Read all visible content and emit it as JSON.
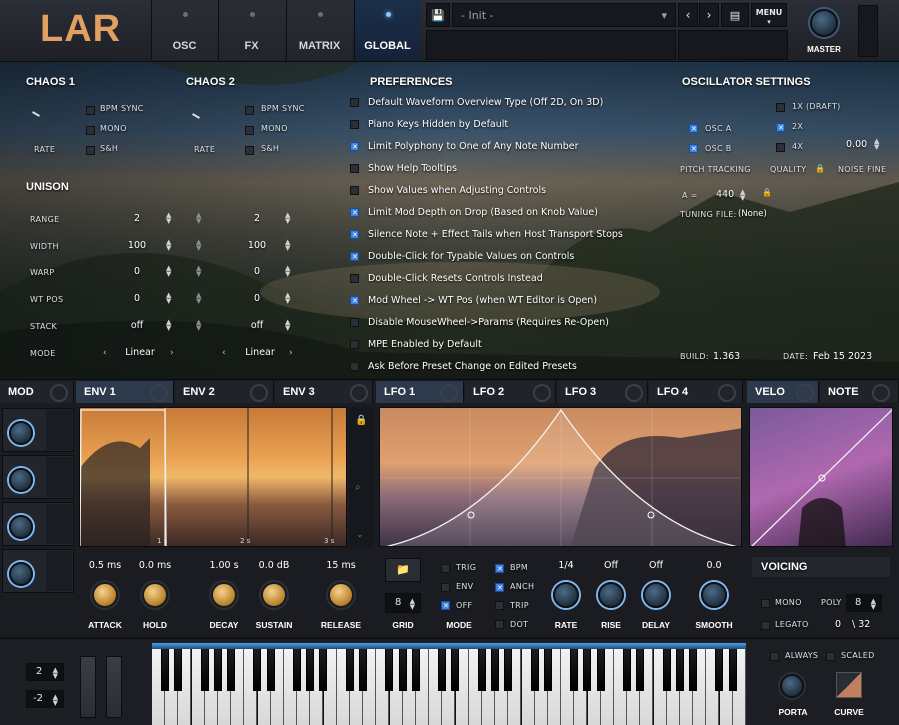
{
  "header": {
    "logo": "LAR",
    "tabs": [
      "OSC",
      "FX",
      "MATRIX",
      "GLOBAL"
    ],
    "preset": "- Init -",
    "menu": "MENU",
    "master": "MASTER"
  },
  "chaos1": {
    "title": "CHAOS 1",
    "bpm_sync": "BPM SYNC",
    "mono": "MONO",
    "rate": "RATE",
    "sh": "S&H"
  },
  "chaos2": {
    "title": "CHAOS 2",
    "bpm_sync": "BPM SYNC",
    "mono": "MONO",
    "rate": "RATE",
    "sh": "S&H"
  },
  "unison": {
    "title": "UNISON",
    "rows": [
      {
        "label": "RANGE",
        "v1": "2",
        "v2": "2"
      },
      {
        "label": "WIDTH",
        "v1": "100",
        "v2": "100"
      },
      {
        "label": "WARP",
        "v1": "0",
        "v2": "0"
      },
      {
        "label": "WT POS",
        "v1": "0",
        "v2": "0"
      },
      {
        "label": "STACK",
        "v1": "off",
        "v2": "off"
      },
      {
        "label": "MODE",
        "v1": "Linear",
        "v2": "Linear"
      }
    ]
  },
  "preferences": {
    "title": "PREFERENCES",
    "items": [
      {
        "text": "Default Waveform Overview Type (Off 2D, On 3D)",
        "on": false
      },
      {
        "text": "Piano Keys Hidden by Default",
        "on": false
      },
      {
        "text": "Limit Polyphony to One of Any Note Number",
        "on": true
      },
      {
        "text": "Show Help Tooltips",
        "on": false
      },
      {
        "text": "Show Values when Adjusting Controls",
        "on": false
      },
      {
        "text": "Limit Mod Depth on Drop (Based on Knob Value)",
        "on": true
      },
      {
        "text": "Silence Note + Effect Tails when Host Transport Stops",
        "on": true
      },
      {
        "text": "Double-Click for Typable Values on Controls",
        "on": true
      },
      {
        "text": "Double-Click Resets Controls Instead",
        "on": false
      },
      {
        "text": "Mod Wheel -> WT Pos (when WT Editor is Open)",
        "on": true
      },
      {
        "text": "Disable MouseWheel->Params (Requires Re-Open)",
        "on": false
      },
      {
        "text": "MPE Enabled by Default",
        "on": false
      },
      {
        "text": "Ask Before Preset Change on Edited Presets",
        "on": false
      }
    ]
  },
  "osc_settings": {
    "title": "OSCILLATOR SETTINGS",
    "draft": "1X (DRAFT)",
    "x2": "2X",
    "x4": "4X",
    "osc_a": "OSC A",
    "osc_b": "OSC B",
    "pitch_tracking": "PITCH TRACKING",
    "quality": "QUALITY",
    "noise_fine": "NOISE FINE",
    "noise_fine_val": "0.00",
    "a_label": "A =",
    "a_val": "440",
    "tuning_label": "TUNING FILE:",
    "tuning_val": "(None)",
    "build_label": "BUILD:",
    "build_val": "1.363",
    "date_label": "DATE:",
    "date_val": "Feb 15 2023"
  },
  "mod": {
    "title": "MOD"
  },
  "env": {
    "tabs": [
      "ENV 1",
      "ENV 2",
      "ENV 3"
    ],
    "time_marks": [
      "1 s",
      "2 s",
      "3 s"
    ],
    "knobs": [
      {
        "label": "ATTACK",
        "value": "0.5 ms"
      },
      {
        "label": "HOLD",
        "value": "0.0 ms"
      },
      {
        "label": "DECAY",
        "value": "1.00 s"
      },
      {
        "label": "SUSTAIN",
        "value": "0.0 dB"
      },
      {
        "label": "RELEASE",
        "value": "15 ms"
      }
    ]
  },
  "lfo": {
    "tabs": [
      "LFO 1",
      "LFO 2",
      "LFO 3",
      "LFO 4"
    ],
    "grid": "GRID",
    "grid_val": "8",
    "mode": "MODE",
    "trig": "TRIG",
    "env": "ENV",
    "off": "OFF",
    "bpm": "BPM",
    "anch": "ANCH",
    "trip": "TRIP",
    "dot": "DOT",
    "knobs": [
      {
        "label": "RATE",
        "value": "1/4"
      },
      {
        "label": "RISE",
        "value": "Off"
      },
      {
        "label": "DELAY",
        "value": "Off"
      },
      {
        "label": "SMOOTH",
        "value": "0.0"
      }
    ]
  },
  "velo": {
    "tabs": [
      "VELO",
      "NOTE"
    ],
    "voicing": "VOICING",
    "mono": "MONO",
    "legato": "LEGATO",
    "poly": "POLY",
    "poly_val": "8",
    "voices": "0",
    "voices_max": "\\ 32"
  },
  "bottom": {
    "pitch1": "2",
    "pitch2": "-2",
    "always": "ALWAYS",
    "scaled": "SCALED",
    "porta": "PORTA",
    "curve": "CURVE"
  }
}
